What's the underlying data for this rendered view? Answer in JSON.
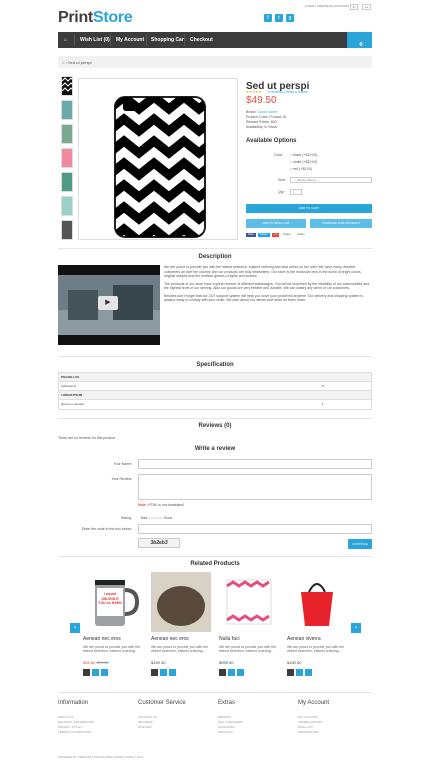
{
  "header": {
    "logo_part1": "Print",
    "logo_part2": "Store",
    "social_icons": [
      "facebook-icon",
      "twitter-icon",
      "google-plus-icon"
    ],
    "top_links": "LOGIN  |  CREATE AN ACCOUNT",
    "currency": "$",
    "language": "en"
  },
  "nav": {
    "items": [
      "Wish List (0)",
      "My Account",
      "Shopping Cart",
      "Checkout"
    ],
    "cart_count": "0"
  },
  "breadcrumb": "Sed ut perspi",
  "product": {
    "title": "Sed ut perspi",
    "price": "$49.50",
    "reviews_text": "0 reviews  |  Write a review",
    "brand_label": "Brand:",
    "brand": "Canon lorem",
    "code": "Product Code: Product 16",
    "reward": "Reward Points: 600",
    "availability": "Availability: In Stock",
    "options_title": "Available Options",
    "color_label": "Color:",
    "colors": [
      "black (+$10.00)",
      "white (+$20.00)",
      "red (+$3.00)"
    ],
    "size_label": "Size:",
    "size_placeholder": " --- Please Select --- ",
    "qty_label": "Qty:",
    "qty": "1",
    "add_to_cart": "ADD TO CART",
    "wishlist": "ADD TO WISH LIST",
    "compare": "COMPARE THIS PRODUCT",
    "share": [
      "Like",
      "Tweet",
      "+1",
      "Share",
      "Share"
    ]
  },
  "description": {
    "title": "Description",
    "p1": "We are proud to provide you with the widest selection, easiest ordering and best prices on the web! We have many devoted customers all over the country and our products are truly bestsellers. Our store is the exclusive lens in the world of bright colors, original shapes and the endless games of lights and shades.",
    "p2": "The products of our store have a great number of different advantages. You will be surprised by the reliability of our commodities and the highest level of our serving. Also our goods are very flexible and durable. We can satisfy any whim of our customers.",
    "p3": "Besides don't forget that our 24/7 support system will help you solve your problems anytime. Our delivery and shipping system is always ready to comply with your order. We care about our clients and never let them down."
  },
  "specification": {
    "title": "Specification",
    "groups": [
      {
        "name": "PHASELLUS",
        "row": "Attributes 5",
        "value": "8"
      },
      {
        "name": "LOREM IPSUM",
        "row": "@Lorem volutpat",
        "value": "1"
      }
    ]
  },
  "reviews": {
    "title": "Reviews (0)",
    "empty": "There are no reviews for this product.",
    "write_title": "Write a review",
    "name_label": "Your Name:",
    "review_label": "Your Review:",
    "note": "Note:",
    "note_text": " HTML is not translated!",
    "rating_label": "Rating:",
    "bad": "Bad",
    "good": "Good",
    "captcha_label": "Enter the code in the box below:",
    "captcha": "3b2eb3",
    "continue": "CONTINUE"
  },
  "related": {
    "title": "Related Products",
    "items": [
      {
        "name": "Aenean nec eros",
        "desc": "We are proud to provide you with the widest selection, easiest ordering...",
        "price_new": "$58.80",
        "price_old": "$74.00"
      },
      {
        "name": "Aenean nec eros",
        "desc": "We are proud to provide you with the widest selection, easiest ordering...",
        "price_new": "$159.30",
        "price_old": ""
      },
      {
        "name": "Nulla faci",
        "desc": "We are proud to provide you with the widest selection, easiest ordering...",
        "price_new": "$999.50",
        "price_old": ""
      },
      {
        "name": "Aenean viverra",
        "desc": "We are proud to provide you with the widest selection, easiest ordering...",
        "price_new": "$180.00",
        "price_old": ""
      }
    ],
    "mug_text": "I would SNUGGLE YOU so HARD"
  },
  "footer": {
    "cols": [
      {
        "title": "Information",
        "links": [
          "ABOUT US",
          "DELIVERY INFORMATION",
          "PRIVACY POLICY",
          "TERMS & CONDITIONS"
        ]
      },
      {
        "title": "Customer Service",
        "links": [
          "CONTACT US",
          "RETURNS",
          "SITE MAP"
        ]
      },
      {
        "title": "Extras",
        "links": [
          "BRANDS",
          "GIFT VOUCHERS",
          "AFFILIATES",
          "SPECIALS"
        ]
      },
      {
        "title": "My Account",
        "links": [
          "MY ACCOUNT",
          "ORDER HISTORY",
          "WISH LIST",
          "NEWSLETTER"
        ]
      }
    ],
    "powered": "POWERED BY  OPENCART PRINTSTORE ONLINE STORE © 2013"
  },
  "colors": {
    "accent": "#2aa5d9",
    "dark": "#3c3c3c",
    "price": "#e04e47"
  }
}
